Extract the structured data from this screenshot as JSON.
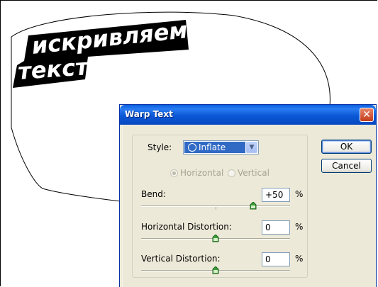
{
  "canvas": {
    "warped_text_line1": "искривляем",
    "warped_text_line2": "текст"
  },
  "dialog": {
    "title": "Warp Text",
    "close_symbol": "✕",
    "style_label": "Style:",
    "style_value": "Inflate",
    "orientation": {
      "horizontal_label": "Horizontal",
      "vertical_label": "Vertical",
      "selected": "Horizontal",
      "enabled": false
    },
    "bend": {
      "label": "Bend:",
      "value": "+50",
      "unit": "%",
      "slider_fraction": 0.75
    },
    "horizontal_distortion": {
      "label": "Horizontal Distortion:",
      "value": "0",
      "unit": "%",
      "slider_fraction": 0.5
    },
    "vertical_distortion": {
      "label": "Vertical Distortion:",
      "value": "0",
      "unit": "%",
      "slider_fraction": 0.5
    },
    "ok_label": "OK",
    "cancel_label": "Cancel"
  }
}
